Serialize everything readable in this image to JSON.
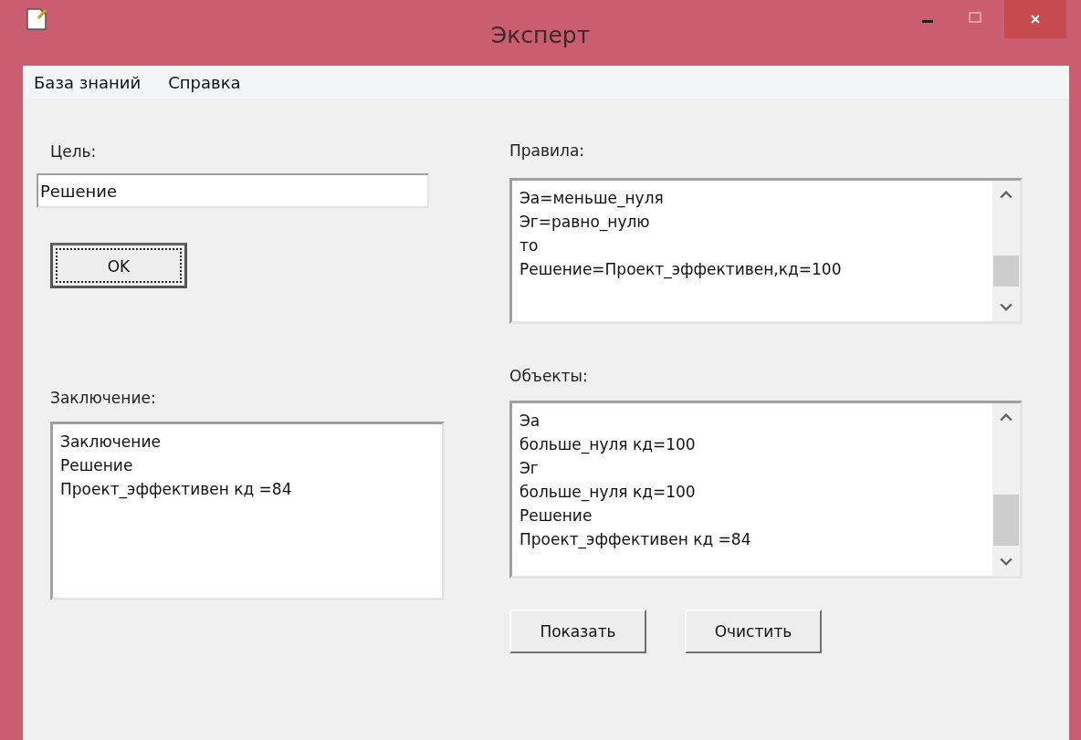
{
  "window": {
    "title": "Эксперт"
  },
  "menu": [
    "База знаний",
    "Справка"
  ],
  "goal": {
    "label": "Цель:",
    "value": "Решение"
  },
  "ok_button": {
    "label": "OK",
    "focused": true
  },
  "conclusion": {
    "label": "Заключение:",
    "lines": [
      "Заключение",
      "Решение",
      "Проект_эффективен кд =84"
    ]
  },
  "rules": {
    "label": "Правила:",
    "lines": [
      "Эа=меньше_нуля",
      "Эг=равно_нулю",
      "то",
      "Решение=Проект_эффективен,кд=100"
    ]
  },
  "objects": {
    "label": "Объекты:",
    "lines": [
      "Эа",
      "больше_нуля кд=100",
      "Эг",
      "больше_нуля кд=100",
      "Решение",
      "Проект_эффективен кд =84"
    ]
  },
  "buttons": [
    "Показать",
    "Очистить"
  ]
}
